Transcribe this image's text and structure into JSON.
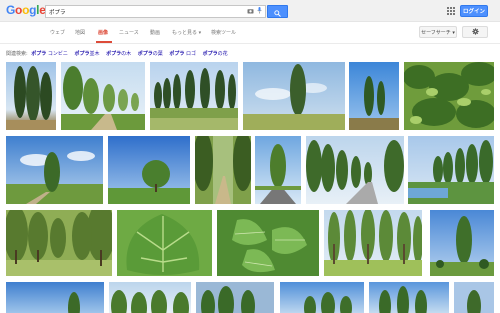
{
  "logo": {
    "letters": [
      "G",
      "o",
      "o",
      "g",
      "l",
      "e"
    ],
    "colors": [
      "#4285f4",
      "#ea4335",
      "#fbbc05",
      "#4285f4",
      "#34a853",
      "#ea4335"
    ]
  },
  "search": {
    "query": "ポプラ",
    "camera_icon": "camera-icon",
    "mic_icon": "microphone-icon"
  },
  "header": {
    "login_label": "ログイン",
    "apps_icon": "apps-grid-icon"
  },
  "tabs": [
    {
      "label": "ウェブ",
      "active": false
    },
    {
      "label": "地図",
      "active": false
    },
    {
      "label": "画像",
      "active": true
    },
    {
      "label": "ニュース",
      "active": false
    },
    {
      "label": "動画",
      "active": false
    },
    {
      "label": "もっと見る ▾",
      "active": false
    },
    {
      "label": "検索ツール",
      "active": false
    }
  ],
  "safesearch_label": "セーフサーチ ▾",
  "settings_icon": "gear-icon",
  "related": {
    "prefix": "関連検索:",
    "terms": [
      {
        "bold": "ポプラ",
        "rest": " コンビニ"
      },
      {
        "bold": "ポプラ",
        "rest": "並木"
      },
      {
        "bold": "ポプラ",
        "rest": "の木"
      },
      {
        "bold": "ポプラ",
        "rest": "の葉"
      },
      {
        "bold": "ポプラ",
        "rest": " ロゴ"
      },
      {
        "bold": "ポプラ",
        "rest": "の花"
      }
    ]
  },
  "colors": {
    "accent": "#dd4b39",
    "link": "#1a0dab",
    "button_blue": "#4d90fe"
  }
}
